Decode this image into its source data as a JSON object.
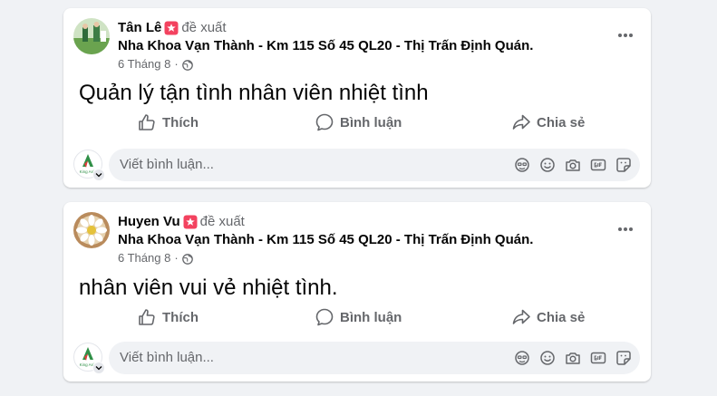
{
  "posts": [
    {
      "author": "Tân Lê",
      "recommend_label": "đề xuất",
      "place": "Nha Khoa Vạn Thành - Km 115 Số 45 QL20 - Thị Trấn Định Quán.",
      "date": "6 Tháng 8",
      "dot": "·",
      "content": "Quản lý tận tình nhân viên nhiệt tình"
    },
    {
      "author": "Huyen Vu",
      "recommend_label": "đề xuất",
      "place": "Nha Khoa Vạn Thành - Km 115 Số 45 QL20 - Thị Trấn Định Quán.",
      "date": "6 Tháng 8",
      "dot": "·",
      "content": "nhân viên vui vẻ nhiệt tình."
    }
  ],
  "actions": {
    "like": "Thích",
    "comment": "Bình luận",
    "share": "Chia sẻ"
  },
  "comment_box": {
    "placeholder": "Viết bình luận...",
    "avatar_logo_text": "King Asin"
  },
  "icons": [
    "more-icon",
    "globe-icon",
    "recommend-icon",
    "like-icon",
    "comment-icon",
    "share-icon",
    "avatar-icon",
    "emoji-icon",
    "camera-icon",
    "gif-icon",
    "sticker-icon"
  ],
  "colors": {
    "background": "#f0f2f5",
    "card": "#ffffff",
    "secondary_text": "#65676b",
    "recommend": "#f3425f"
  }
}
